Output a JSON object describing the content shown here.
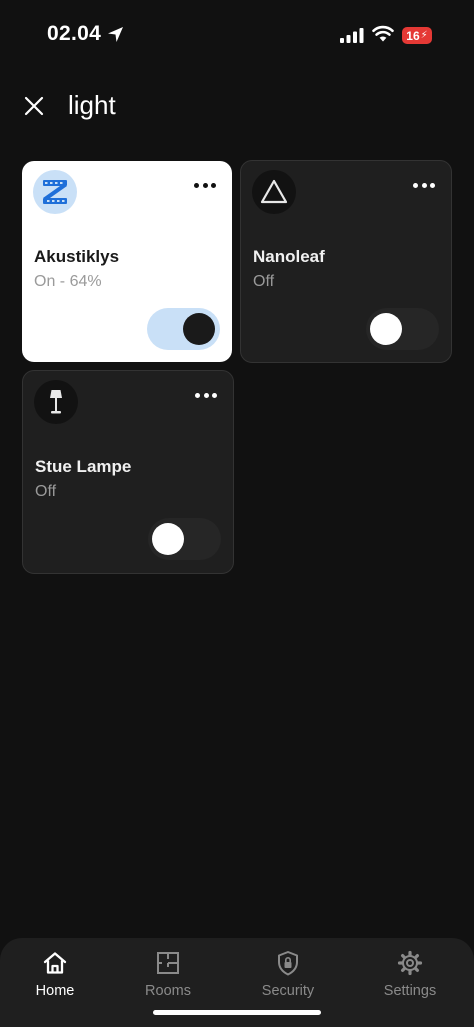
{
  "status_bar": {
    "time": "02.04",
    "battery": "16"
  },
  "search": {
    "query": "light"
  },
  "devices": [
    {
      "name": "Akustiklys",
      "state": "On - 64%",
      "on": true,
      "icon": "led-strip-icon"
    },
    {
      "name": "Nanoleaf",
      "state": "Off",
      "on": false,
      "icon": "triangle-icon"
    },
    {
      "name": "Stue Lampe",
      "state": "Off",
      "on": false,
      "icon": "floor-lamp-icon"
    }
  ],
  "nav": [
    {
      "label": "Home",
      "active": true,
      "icon": "home-icon"
    },
    {
      "label": "Rooms",
      "active": false,
      "icon": "floorplan-icon"
    },
    {
      "label": "Security",
      "active": false,
      "icon": "shield-lock-icon"
    },
    {
      "label": "Settings",
      "active": false,
      "icon": "gear-icon"
    }
  ],
  "colors": {
    "background": "#111111",
    "card_off": "#1f1f1f",
    "card_on": "#ffffff",
    "accent": "#c9e0f7",
    "battery": "#e53935"
  }
}
